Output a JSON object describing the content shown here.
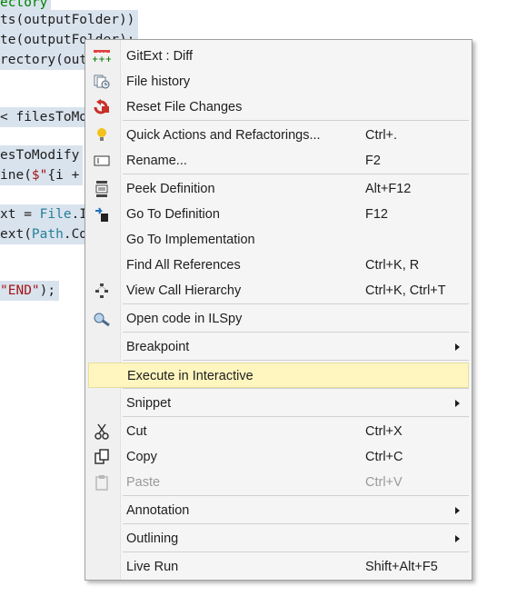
{
  "editor": {
    "lines": [
      {
        "segments": [
          {
            "t": "ectory",
            "c": "grn"
          }
        ]
      },
      {
        "segments": [
          {
            "t": "ts(outputFolder))",
            "c": ""
          }
        ]
      },
      {
        "segments": [
          {
            "t": "te(outputFolder);",
            "c": ""
          }
        ]
      },
      {
        "segments": [
          {
            "t": "rectory(out",
            "c": ""
          }
        ]
      },
      {
        "segments": [
          {
            "t": "< filesToMo",
            "c": ""
          }
        ]
      },
      {
        "segments": [
          {
            "t": "esToModify",
            "c": ""
          }
        ]
      },
      {
        "segments": [
          {
            "t": "ine(",
            "c": ""
          },
          {
            "t": "$\"",
            "c": "str"
          },
          {
            "t": "{i +",
            "c": ""
          }
        ]
      },
      {
        "segments": [
          {
            "t": "xt = ",
            "c": ""
          },
          {
            "t": "File",
            "c": "kw"
          },
          {
            "t": ".I",
            "c": ""
          }
        ]
      },
      {
        "segments": [
          {
            "t": "ext(",
            "c": ""
          },
          {
            "t": "Path",
            "c": "kw"
          },
          {
            "t": ".Co",
            "c": ""
          }
        ]
      },
      {
        "segments": [
          {
            "t": "\"END\"",
            "c": "str"
          },
          {
            "t": ");",
            "c": ""
          }
        ]
      }
    ]
  },
  "menu": {
    "items": [
      {
        "name": "gitext-diff",
        "icon": "git-diff-icon",
        "label": "GitExt : Diff",
        "shortcut": "",
        "submenu": false,
        "disabled": false
      },
      {
        "name": "file-history",
        "icon": "file-history-icon",
        "label": "File history",
        "shortcut": "",
        "submenu": false,
        "disabled": false
      },
      {
        "name": "reset-file-changes",
        "icon": "reset-icon",
        "label": "Reset File Changes",
        "shortcut": "",
        "submenu": false,
        "disabled": false
      },
      {
        "name": "quick-actions",
        "icon": "lightbulb-icon",
        "label": "Quick Actions and Refactorings...",
        "shortcut": "Ctrl+.",
        "submenu": false,
        "disabled": false
      },
      {
        "name": "rename",
        "icon": "rename-icon",
        "label": "Rename...",
        "shortcut": "F2",
        "submenu": false,
        "disabled": false
      },
      {
        "name": "peek-definition",
        "icon": "peek-definition-icon",
        "label": "Peek Definition",
        "shortcut": "Alt+F12",
        "submenu": false,
        "disabled": false
      },
      {
        "name": "go-to-definition",
        "icon": "go-to-definition-icon",
        "label": "Go To Definition",
        "shortcut": "F12",
        "submenu": false,
        "disabled": false
      },
      {
        "name": "go-to-implementation",
        "icon": "",
        "label": "Go To Implementation",
        "shortcut": "",
        "submenu": false,
        "disabled": false
      },
      {
        "name": "find-all-references",
        "icon": "",
        "label": "Find All References",
        "shortcut": "Ctrl+K, R",
        "submenu": false,
        "disabled": false
      },
      {
        "name": "view-call-hierarchy",
        "icon": "call-hierarchy-icon",
        "label": "View Call Hierarchy",
        "shortcut": "Ctrl+K, Ctrl+T",
        "submenu": false,
        "disabled": false
      },
      {
        "name": "open-in-ilspy",
        "icon": "ilspy-icon",
        "label": "Open code in ILSpy",
        "shortcut": "",
        "submenu": false,
        "disabled": false
      },
      {
        "name": "breakpoint",
        "icon": "",
        "label": "Breakpoint",
        "shortcut": "",
        "submenu": true,
        "disabled": false
      },
      {
        "name": "execute-in-interactive",
        "icon": "",
        "label": "Execute in Interactive",
        "shortcut": "",
        "submenu": false,
        "disabled": false,
        "highlighted": true
      },
      {
        "name": "snippet",
        "icon": "",
        "label": "Snippet",
        "shortcut": "",
        "submenu": true,
        "disabled": false
      },
      {
        "name": "cut",
        "icon": "scissors-icon",
        "label": "Cut",
        "shortcut": "Ctrl+X",
        "submenu": false,
        "disabled": false
      },
      {
        "name": "copy",
        "icon": "copy-icon",
        "label": "Copy",
        "shortcut": "Ctrl+C",
        "submenu": false,
        "disabled": false
      },
      {
        "name": "paste",
        "icon": "paste-icon",
        "label": "Paste",
        "shortcut": "Ctrl+V",
        "submenu": false,
        "disabled": true
      },
      {
        "name": "annotation",
        "icon": "",
        "label": "Annotation",
        "shortcut": "",
        "submenu": true,
        "disabled": false
      },
      {
        "name": "outlining",
        "icon": "",
        "label": "Outlining",
        "shortcut": "",
        "submenu": true,
        "disabled": false
      },
      {
        "name": "live-run",
        "icon": "",
        "label": "Live Run",
        "shortcut": "Shift+Alt+F5",
        "submenu": false,
        "disabled": false
      }
    ]
  },
  "colors": {
    "highlight": "#fff6bf",
    "menu_bg": "#f5f5f5",
    "code_string": "#a31515",
    "code_type": "#267f99"
  }
}
